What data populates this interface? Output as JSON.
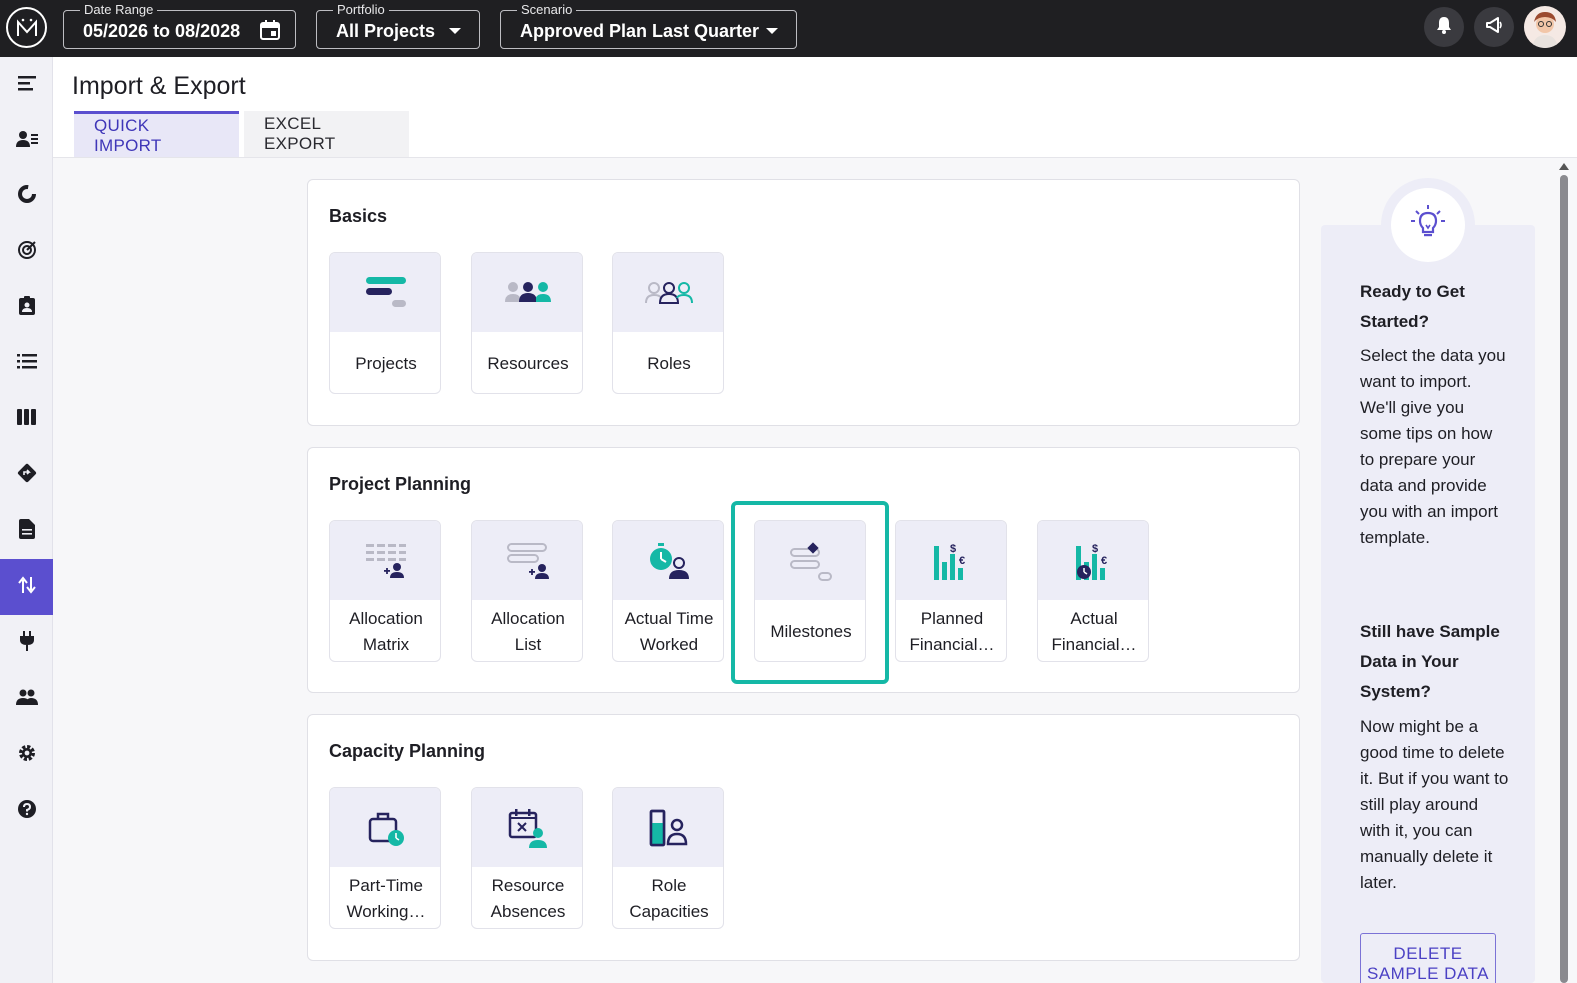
{
  "topbar": {
    "date_range": {
      "label": "Date Range",
      "value": "05/2026 to 08/2028"
    },
    "portfolio": {
      "label": "Portfolio",
      "value": "All Projects"
    },
    "scenario": {
      "label": "Scenario",
      "value": "Approved Plan Last Quarter"
    }
  },
  "page": {
    "title": "Import & Export",
    "tabs": [
      {
        "label": "QUICK IMPORT",
        "active": true
      },
      {
        "label": "EXCEL EXPORT",
        "active": false
      }
    ]
  },
  "sections": {
    "basics": {
      "title": "Basics",
      "cards": [
        {
          "label": "Projects",
          "icon": "projects-icon"
        },
        {
          "label": "Resources",
          "icon": "resources-icon"
        },
        {
          "label": "Roles",
          "icon": "roles-icon"
        }
      ]
    },
    "project_planning": {
      "title": "Project Planning",
      "cards": [
        {
          "label": "Allocation Matrix",
          "icon": "allocation-matrix-icon"
        },
        {
          "label": "Allocation List",
          "icon": "allocation-list-icon"
        },
        {
          "label": "Actual Time Worked",
          "icon": "actual-time-worked-icon"
        },
        {
          "label": "Milestones",
          "icon": "milestones-icon"
        },
        {
          "label": "Planned Financial…",
          "icon": "planned-financials-icon"
        },
        {
          "label": "Actual Financial…",
          "icon": "actual-financials-icon"
        }
      ]
    },
    "capacity_planning": {
      "title": "Capacity Planning",
      "cards": [
        {
          "label": "Part-Time Working…",
          "icon": "part-time-working-icon"
        },
        {
          "label": "Resource Absences",
          "icon": "resource-absences-icon"
        },
        {
          "label": "Role Capacities",
          "icon": "role-capacities-icon"
        }
      ]
    }
  },
  "tips": {
    "heading1": "Ready to Get Started?",
    "text1": "Select the data you want to import. We'll give you some tips on how to prepare your data and provide you with an import template.",
    "heading2": "Still have Sample Data in Your System?",
    "text2": "Now might be a good time to delete it. But if you want to still play around with it, you can manually delete it later.",
    "button": "DELETE SAMPLE DATA"
  },
  "colors": {
    "accent": "#5b4fcf",
    "teal": "#15b8a6",
    "navy": "#26235e",
    "topbar": "#1f1f22"
  }
}
